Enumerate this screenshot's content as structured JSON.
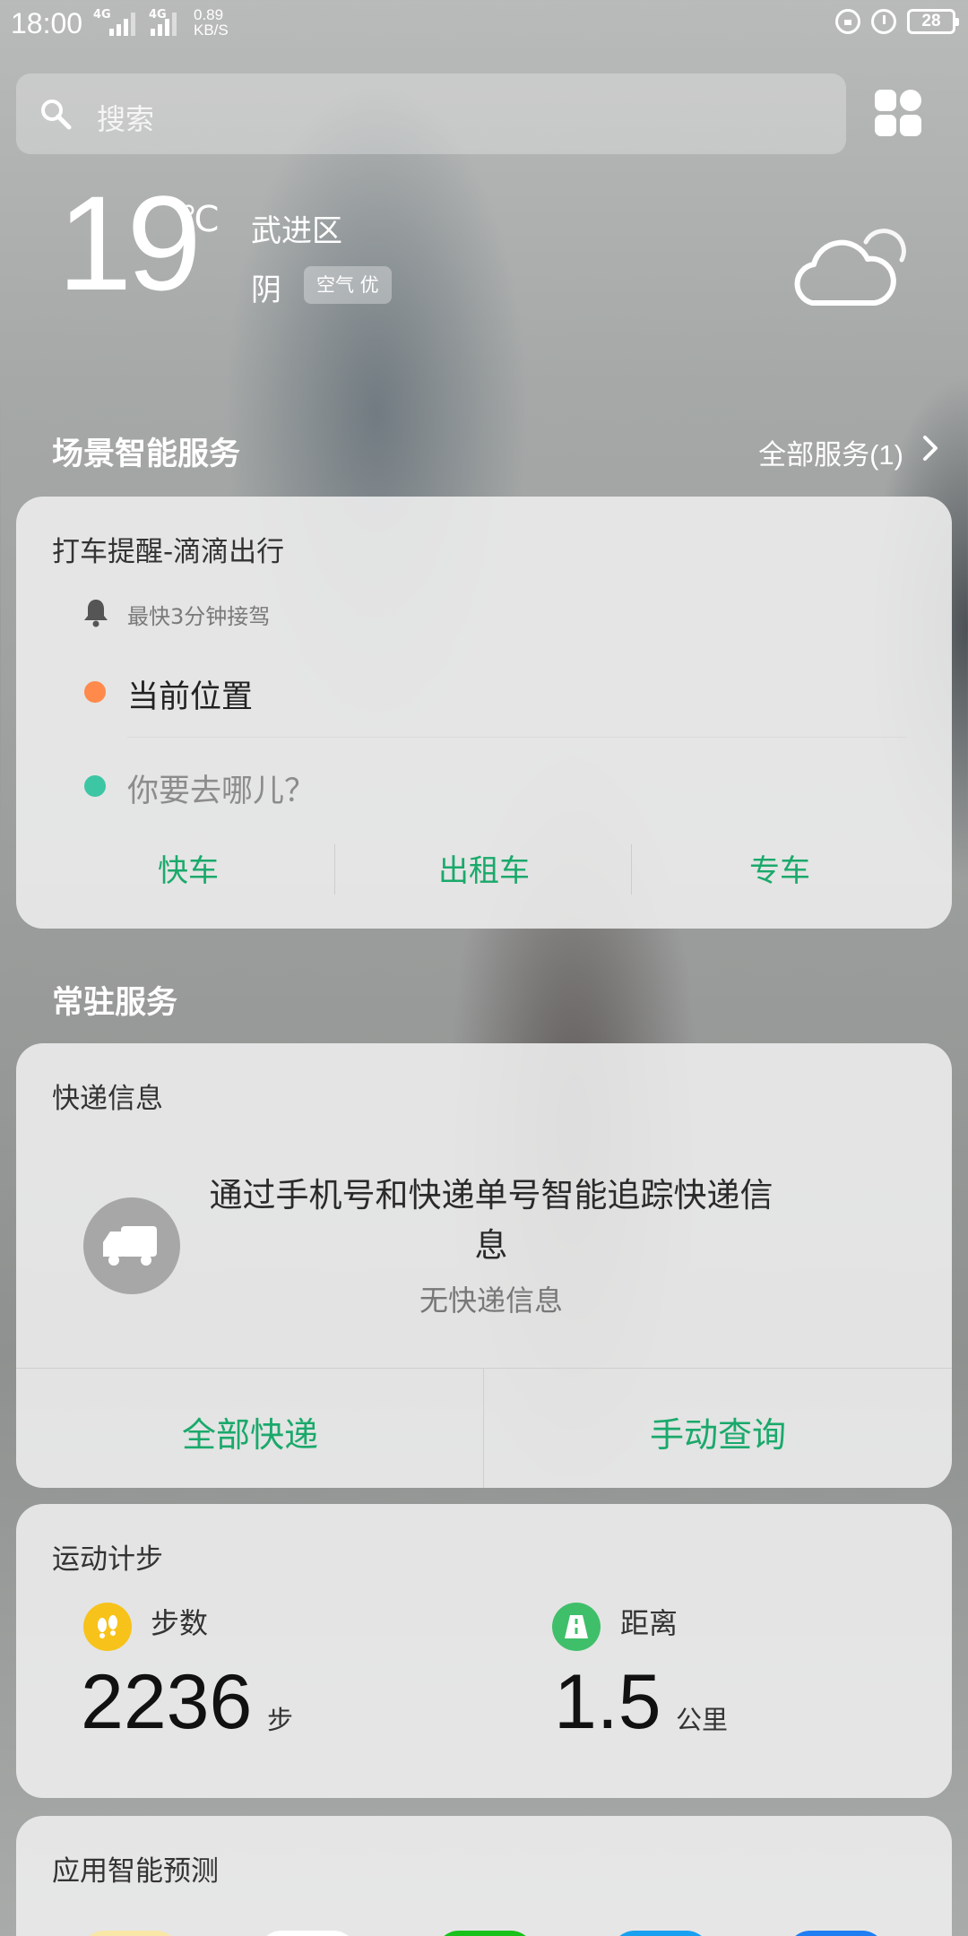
{
  "status_bar": {
    "time": "18:00",
    "sim1_network": "4G",
    "sim2_network": "4G",
    "net_speed_value": "0.89",
    "net_speed_unit": "KB/S",
    "battery": "28",
    "icons": [
      "rotation-lock-icon",
      "alarm-icon",
      "battery-icon"
    ]
  },
  "search": {
    "placeholder": "搜索",
    "icon": "search-icon"
  },
  "weather": {
    "temperature": "19",
    "unit": "℃",
    "location": "武进区",
    "condition": "阴",
    "air_quality": "空气 优",
    "icon": "cloudy-icon"
  },
  "scene_section": {
    "title": "场景智能服务",
    "all_services": "全部服务(1)"
  },
  "taxi_card": {
    "title": "打车提醒-滴滴出行",
    "hint": "最快3分钟接驾",
    "from": "当前位置",
    "to_placeholder": "你要去哪儿？",
    "buttons": [
      "快车",
      "出租车",
      "专车"
    ],
    "colors": {
      "from_dot": "#ff8a4c",
      "to_dot": "#3cc6a4",
      "accent": "#1aa96b"
    }
  },
  "resident_section": {
    "title": "常驻服务"
  },
  "express_card": {
    "title": "快递信息",
    "description": "通过手机号和快递单号智能追踪快递信息",
    "empty": "无快递信息",
    "buttons": [
      "全部快递",
      "手动查询"
    ]
  },
  "steps_card": {
    "title": "运动计步",
    "steps_label": "步数",
    "steps_value": "2236",
    "steps_unit": "步",
    "distance_label": "距离",
    "distance_value": "1.5",
    "distance_unit": "公里"
  },
  "app_prediction_card": {
    "title": "应用智能预测"
  }
}
